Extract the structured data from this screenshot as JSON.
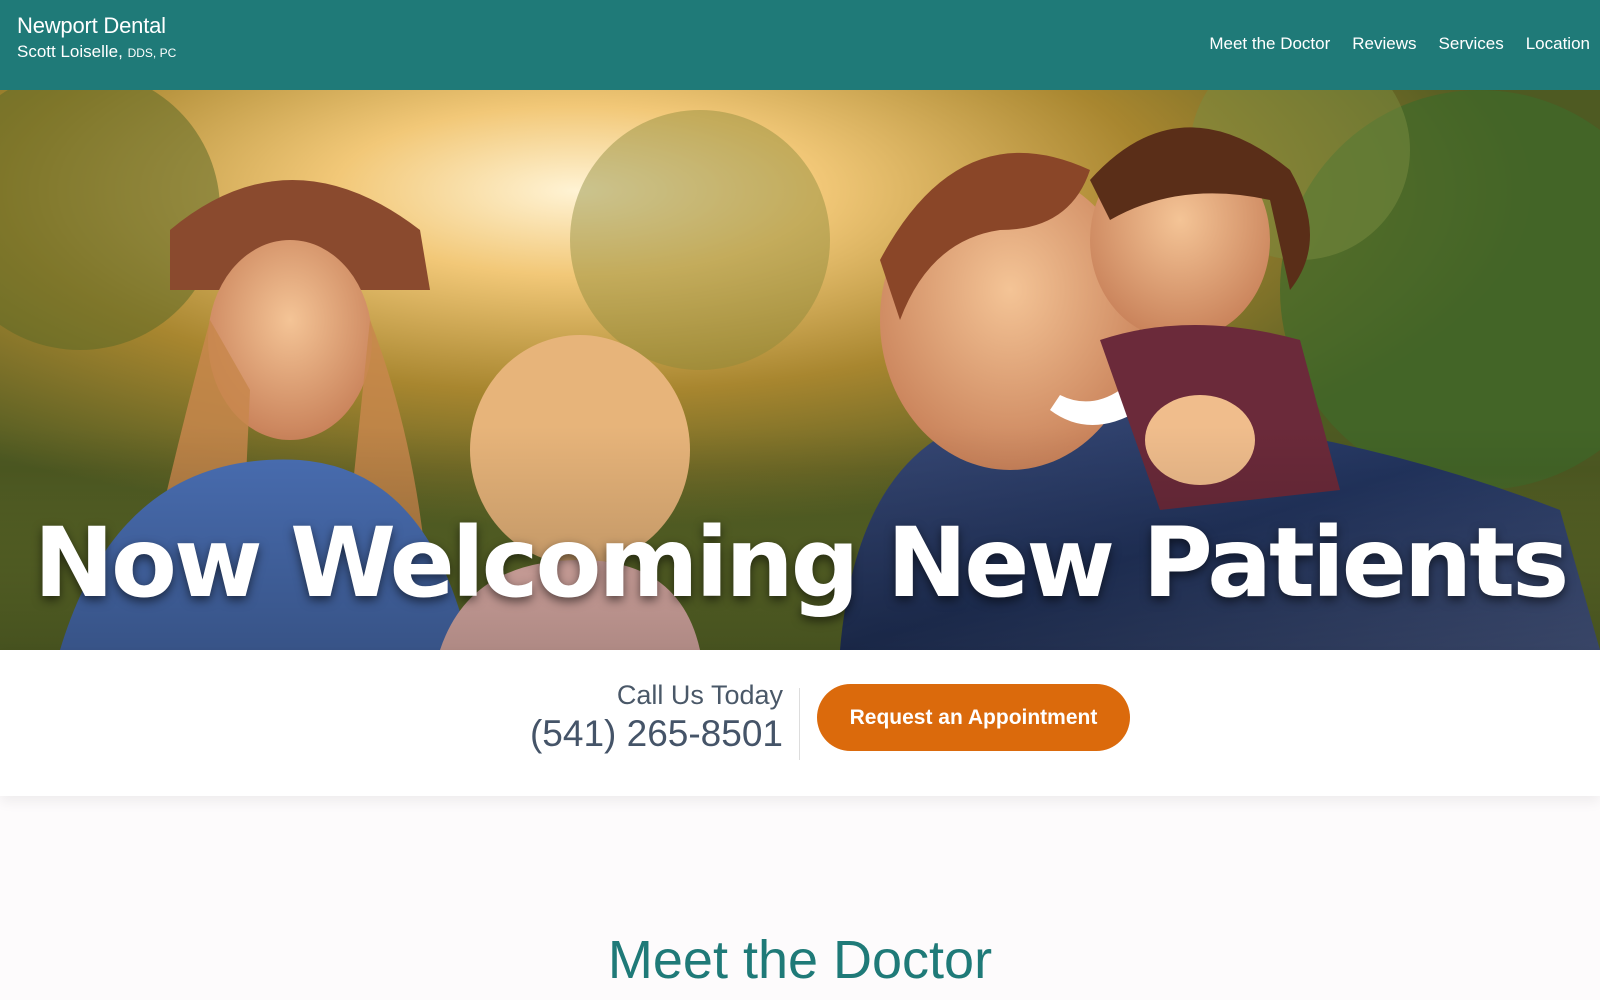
{
  "header": {
    "practice_name": "Newport Dental",
    "doctor_name": "Scott Loiselle,",
    "doctor_credentials": "DDS, PC",
    "nav": [
      {
        "label": "Meet the Doctor"
      },
      {
        "label": "Reviews"
      },
      {
        "label": "Services"
      },
      {
        "label": "Location"
      }
    ]
  },
  "hero": {
    "headline": "Now Welcoming New Patients"
  },
  "contact": {
    "call_label": "Call Us Today",
    "phone": "(541) 265-8501",
    "appointment_button": "Request an Appointment"
  },
  "section": {
    "heading": "Meet the Doctor"
  },
  "colors": {
    "header_bg": "#1f7a78",
    "accent_orange": "#db6a0c",
    "heading_teal": "#1f7a78"
  }
}
